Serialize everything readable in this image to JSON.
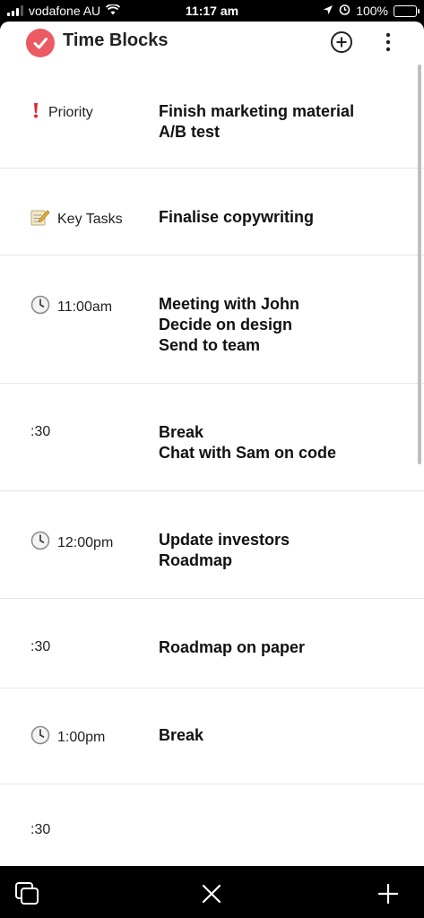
{
  "status_bar": {
    "carrier": "vodafone AU",
    "time": "11:17 am",
    "battery": "100%"
  },
  "app": {
    "title": "Time Blocks"
  },
  "blocks": [
    {
      "icon": "exclamation-icon",
      "time": "Priority",
      "lines": [
        "Finish marketing material",
        "A/B test"
      ]
    },
    {
      "icon": "memo-icon",
      "time": "Key Tasks",
      "lines": [
        "Finalise copywriting"
      ]
    },
    {
      "icon": "clock-icon",
      "time": "11:00am",
      "lines": [
        "Meeting with John",
        "Decide on design",
        "Send to team"
      ]
    },
    {
      "icon": "",
      "time": ":30",
      "lines": [
        "Break",
        "Chat with Sam on code"
      ]
    },
    {
      "icon": "clock-icon",
      "time": "12:00pm",
      "lines": [
        "Update investors",
        "Roadmap"
      ]
    },
    {
      "icon": "",
      "time": ":30",
      "lines": [
        "Roadmap on paper"
      ]
    },
    {
      "icon": "clock-icon",
      "time": "1:00pm",
      "lines": [
        "Break"
      ]
    },
    {
      "icon": "",
      "time": ":30",
      "lines": []
    }
  ],
  "colors": {
    "accent": "#ea5b63",
    "battery": "#4cd964"
  }
}
